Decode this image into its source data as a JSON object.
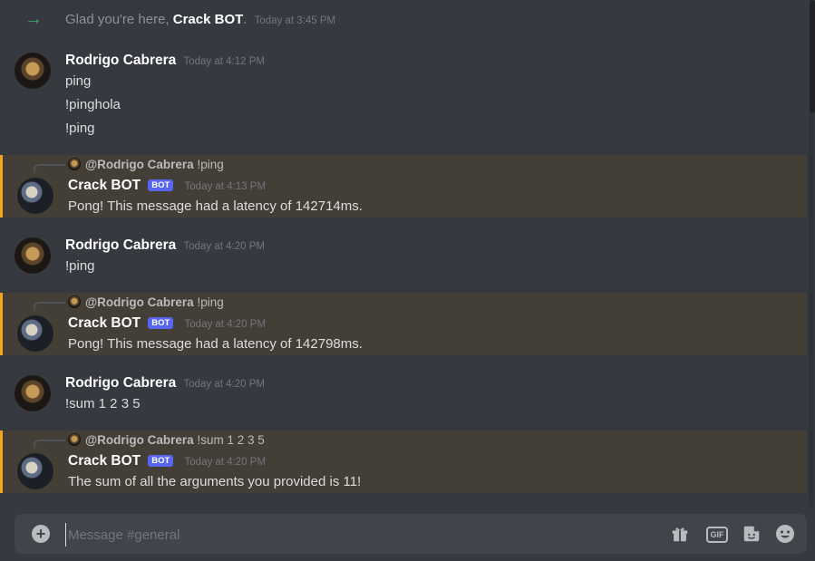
{
  "system": {
    "prefix": "Glad you're here, ",
    "name": "Crack BOT",
    "suffix": ".",
    "timestamp": "Today at 3:45 PM"
  },
  "messages": [
    {
      "author": "Rodrigo Cabrera",
      "timestamp": "Today at 4:12 PM",
      "lines": [
        "ping",
        "!pinghola",
        "!ping"
      ]
    },
    {
      "author": "Crack BOT",
      "badge": "BOT",
      "timestamp": "Today at 4:13 PM",
      "reply_to": {
        "mention": "@Rodrigo Cabrera",
        "text": "!ping"
      },
      "lines": [
        "Pong! This message had a latency of 142714ms."
      ]
    },
    {
      "author": "Rodrigo Cabrera",
      "timestamp": "Today at 4:20 PM",
      "lines": [
        "!ping"
      ]
    },
    {
      "author": "Crack BOT",
      "badge": "BOT",
      "timestamp": "Today at 4:20 PM",
      "reply_to": {
        "mention": "@Rodrigo Cabrera",
        "text": "!ping"
      },
      "lines": [
        "Pong! This message had a latency of 142798ms."
      ]
    },
    {
      "author": "Rodrigo Cabrera",
      "timestamp": "Today at 4:20 PM",
      "lines": [
        "!sum 1 2 3 5"
      ]
    },
    {
      "author": "Crack BOT",
      "badge": "BOT",
      "timestamp": "Today at 4:20 PM",
      "reply_to": {
        "mention": "@Rodrigo Cabrera",
        "text": "!sum 1 2 3 5"
      },
      "lines": [
        "The sum of all the arguments you provided is 11!"
      ]
    }
  ],
  "composer": {
    "placeholder": "Message #general",
    "plus_icon": "plus-circle-icon",
    "gift_icon": "gift-icon",
    "gif_label": "GIF",
    "sticker_icon": "sticker-icon",
    "emoji_icon": "emoji-icon"
  },
  "colors": {
    "background": "#36393f",
    "highlight": "#433f37",
    "highlight_border": "#faa61a",
    "bot_badge": "#5865f2",
    "join_arrow": "#3ba55d"
  }
}
